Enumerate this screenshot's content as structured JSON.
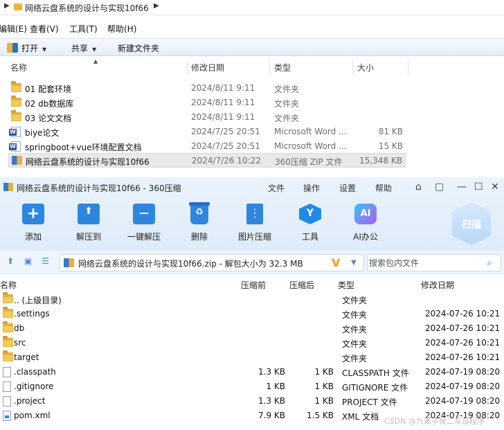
{
  "explorer": {
    "breadcrumb": "网络云盘系统的设计与实现10f66",
    "menu": [
      "编辑(E)",
      "查看(V)",
      "工具(T)",
      "帮助(H)"
    ],
    "toolbar": {
      "open": "打开",
      "share": "共享",
      "new_folder": "新建文件夹"
    },
    "columns": {
      "name": "名称",
      "date": "修改日期",
      "type": "类型",
      "size": "大小"
    },
    "rows": [
      {
        "icon": "folder-icon",
        "name": "01 配套环境",
        "date": "2024/8/11 9:11",
        "type": "文件夹",
        "size": ""
      },
      {
        "icon": "folder-icon",
        "name": "02 db数据库",
        "date": "2024/8/11 9:11",
        "type": "文件夹",
        "size": ""
      },
      {
        "icon": "folder-icon",
        "name": "03 论文文档",
        "date": "2024/8/11 9:11",
        "type": "文件夹",
        "size": ""
      },
      {
        "icon": "word-doc-icon",
        "name": "biye论文",
        "date": "2024/7/25 20:51",
        "type": "Microsoft Word ...",
        "size": "81 KB"
      },
      {
        "icon": "word-doc-icon",
        "name": "springboot+vue环境配置文档",
        "date": "2024/7/25 20:51",
        "type": "Microsoft Word ...",
        "size": "15 KB"
      },
      {
        "icon": "zip-archive-icon",
        "name": "网络云盘系统的设计与实现10f66",
        "date": "2024/7/26 10:22",
        "type": "360压缩 ZIP 文件",
        "size": "15,348 KB"
      }
    ]
  },
  "zip": {
    "title": "网络云盘系统的设计与实现10f66 - 360压缩",
    "menu": [
      "文件",
      "操作",
      "设置",
      "帮助"
    ],
    "tools": [
      {
        "label": "添加",
        "icon": "add-icon"
      },
      {
        "label": "解压到",
        "icon": "extract-to-icon"
      },
      {
        "label": "一键解压",
        "icon": "one-click-extract-icon"
      },
      {
        "label": "删除",
        "icon": "delete-icon"
      },
      {
        "label": "图片压缩",
        "icon": "image-compress-icon"
      },
      {
        "label": "工具",
        "icon": "tools-icon"
      },
      {
        "label": "AI办公",
        "icon": "ai-office-icon"
      }
    ],
    "scan_label": "扫描",
    "path": "网络云盘系统的设计与实现10f66.zip - 解包大小为 32.3 MB",
    "search_placeholder": "搜索包内文件",
    "columns": {
      "name": "名称",
      "compressed": "压缩前",
      "original": "压缩后",
      "type": "类型",
      "date": "修改日期"
    },
    "rows": [
      {
        "icon": "folder-icon",
        "name": ".. (上级目录)",
        "csize": "",
        "osize": "",
        "type": "文件夹",
        "date": ""
      },
      {
        "icon": "folder-icon",
        "name": ".settings",
        "csize": "",
        "osize": "",
        "type": "文件夹",
        "date": "2024-07-26 10:21"
      },
      {
        "icon": "folder-icon",
        "name": "db",
        "csize": "",
        "osize": "",
        "type": "文件夹",
        "date": "2024-07-26 10:21"
      },
      {
        "icon": "folder-icon",
        "name": "src",
        "csize": "",
        "osize": "",
        "type": "文件夹",
        "date": "2024-07-26 10:21"
      },
      {
        "icon": "folder-icon",
        "name": "target",
        "csize": "",
        "osize": "",
        "type": "文件夹",
        "date": "2024-07-26 10:21"
      },
      {
        "icon": "file-icon",
        "name": ".classpath",
        "csize": "1.3 KB",
        "osize": "1 KB",
        "type": "CLASSPATH 文件",
        "date": "2024-07-19 08:20"
      },
      {
        "icon": "file-icon",
        "name": ".gitignore",
        "csize": "1 KB",
        "osize": "1 KB",
        "type": "GITIGNORE 文件",
        "date": "2024-07-19 08:20"
      },
      {
        "icon": "file-icon",
        "name": ".project",
        "csize": "1.3 KB",
        "osize": "1 KB",
        "type": "PROJECT 文件",
        "date": "2024-07-19 08:20"
      },
      {
        "icon": "xml-file-icon",
        "name": "pom.xml",
        "csize": "7.9 KB",
        "osize": "1.5 KB",
        "type": "XML 文档",
        "date": "2024-07-19 08:20"
      }
    ]
  },
  "watermark": "CSDN @九果子侯二车设程序"
}
